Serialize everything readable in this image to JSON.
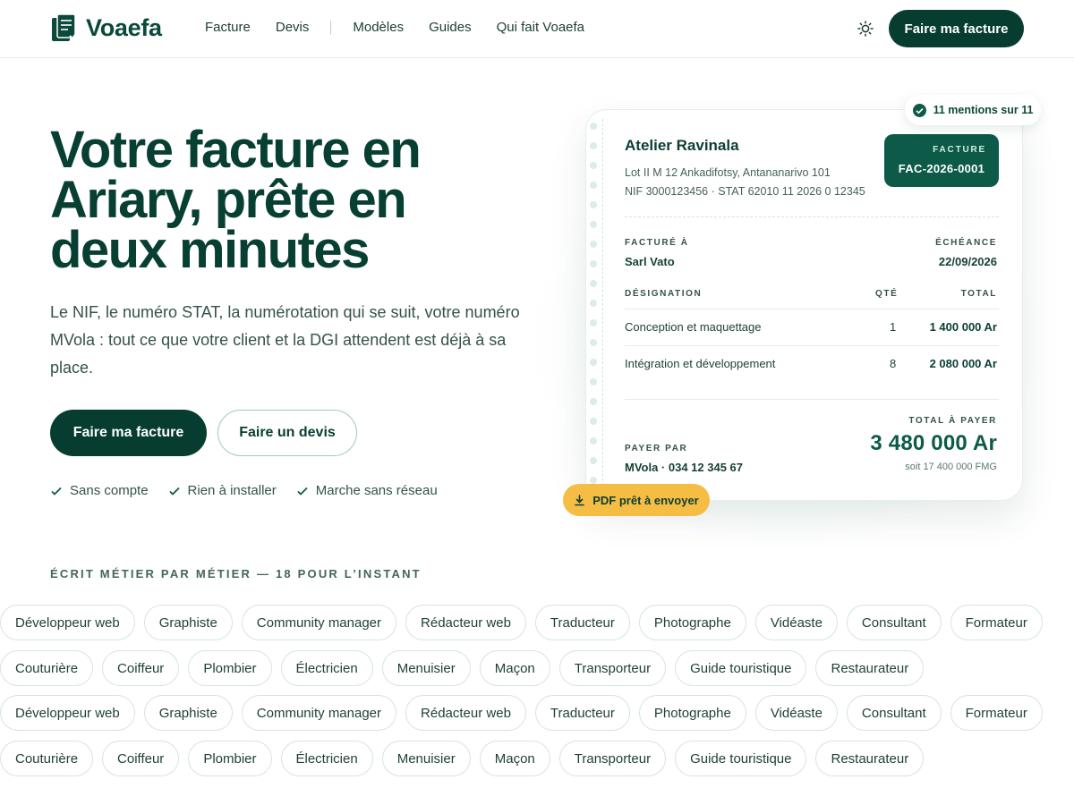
{
  "brand": {
    "name": "Voaefa"
  },
  "nav": {
    "items": [
      "Facture",
      "Devis",
      "Modèles",
      "Guides",
      "Qui fait Voaefa"
    ],
    "cta": "Faire ma facture"
  },
  "hero": {
    "title": "Votre facture en Ariary, prête en deux minutes",
    "subtitle": "Le NIF, le numéro STAT, la numérotation qui se suit, votre numéro MVola : tout ce que votre client et la DGI attendent est déjà à sa place.",
    "primary_button": "Faire ma facture",
    "secondary_button": "Faire un devis",
    "checks": [
      "Sans compte",
      "Rien à installer",
      "Marche sans réseau"
    ]
  },
  "invoice": {
    "mentions_badge": "11 mentions sur 11",
    "company": "Atelier Ravinala",
    "address_line1": "Lot II M 12 Ankadifotsy, Antananarivo 101",
    "address_line2": "NIF 3000123456 · STAT 62010 11 2026 0 12345",
    "doc_label": "FACTURE",
    "doc_number": "FAC-2026-0001",
    "billed_to_label": "FACTURÉ À",
    "billed_to": "Sarl Vato",
    "due_label": "ÉCHÉANCE",
    "due_date": "22/09/2026",
    "col_designation": "DÉSIGNATION",
    "col_qty": "QTÉ",
    "col_total": "TOTAL",
    "lines": [
      {
        "designation": "Conception et maquettage",
        "qty": "1",
        "total": "1 400 000 Ar"
      },
      {
        "designation": "Intégration et développement",
        "qty": "8",
        "total": "2 080 000 Ar"
      }
    ],
    "pay_by_label": "PAYER PAR",
    "pay_by": "MVola · 034 12 345 67",
    "total_label": "TOTAL À PAYER",
    "total": "3 480 000 Ar",
    "total_fmg": "soit 17 400 000 FMG",
    "pdf_pill": "PDF prêt à envoyer"
  },
  "metiers": {
    "title": "ÉCRIT MÉTIER PAR MÉTIER — 18 POUR L’INSTANT",
    "row_a": [
      "Développeur web",
      "Graphiste",
      "Community manager",
      "Rédacteur web",
      "Traducteur",
      "Photographe",
      "Vidéaste",
      "Consultant",
      "Formateur"
    ],
    "row_b": [
      "Couturière",
      "Coiffeur",
      "Plombier",
      "Électricien",
      "Menuisier",
      "Maçon",
      "Transporteur",
      "Guide touristique",
      "Restaurateur"
    ]
  },
  "colors": {
    "primary": "#073d31",
    "accent": "#f6bd45",
    "badge": "#0c5a47"
  }
}
